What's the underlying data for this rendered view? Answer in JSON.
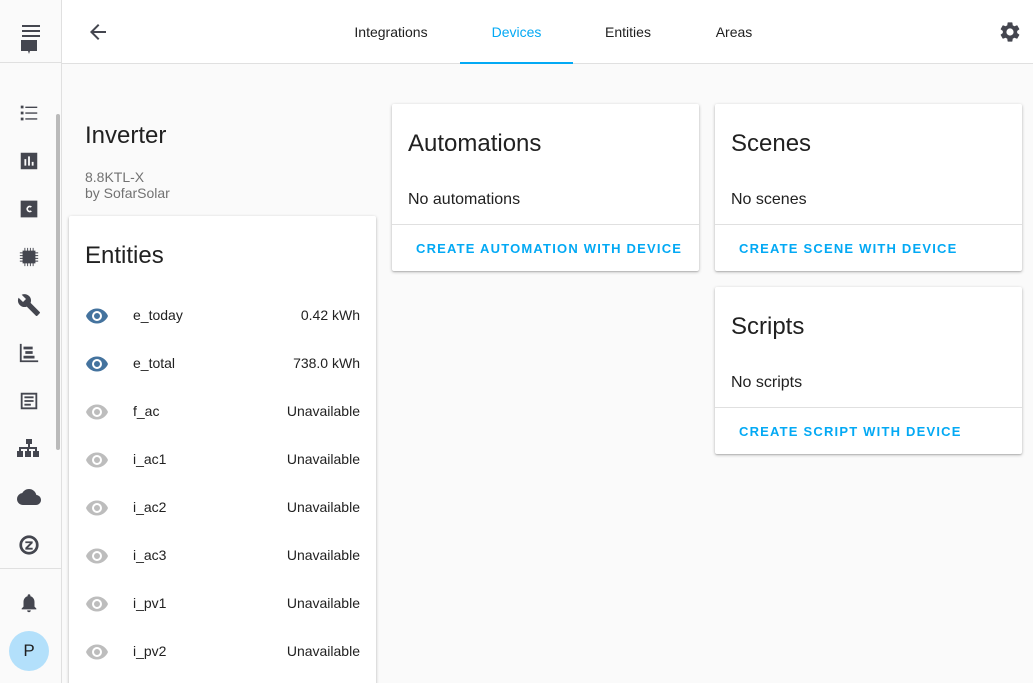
{
  "tabs": [
    {
      "label": "Integrations"
    },
    {
      "label": "Devices",
      "active": true
    },
    {
      "label": "Entities"
    },
    {
      "label": "Areas"
    }
  ],
  "user": {
    "initial": "P"
  },
  "sidebar": {
    "icons": [
      "dashboard-icon",
      "logbook-icon",
      "history-icon",
      "hacs-icon",
      "esphome-icon",
      "developer-tools-icon",
      "node-red-icon",
      "file-editor-icon",
      "zigbee-network-icon",
      "cloud-icon",
      "z-wave-icon",
      "notifications-icon"
    ]
  },
  "device": {
    "name": "Inverter",
    "model": "8.8KTL-X",
    "manufacturer": "by SofarSolar"
  },
  "entities_card": {
    "title": "Entities",
    "rows": [
      {
        "name": "e_today",
        "state": "0.42 kWh",
        "visible": true
      },
      {
        "name": "e_total",
        "state": "738.0 kWh",
        "visible": true
      },
      {
        "name": "f_ac",
        "state": "Unavailable",
        "visible": false
      },
      {
        "name": "i_ac1",
        "state": "Unavailable",
        "visible": false
      },
      {
        "name": "i_ac2",
        "state": "Unavailable",
        "visible": false
      },
      {
        "name": "i_ac3",
        "state": "Unavailable",
        "visible": false
      },
      {
        "name": "i_pv1",
        "state": "Unavailable",
        "visible": false
      },
      {
        "name": "i_pv2",
        "state": "Unavailable",
        "visible": false
      }
    ]
  },
  "automations_card": {
    "title": "Automations",
    "empty_text": "No automations",
    "action_label": "CREATE AUTOMATION WITH DEVICE"
  },
  "scenes_card": {
    "title": "Scenes",
    "empty_text": "No scenes",
    "action_label": "CREATE SCENE WITH DEVICE"
  },
  "scripts_card": {
    "title": "Scripts",
    "empty_text": "No scripts",
    "action_label": "CREATE SCRIPT WITH DEVICE"
  },
  "colors": {
    "accent": "#03a9f4",
    "eye_active": "#44739e",
    "eye_inactive": "#bdbdbd",
    "sidebar_icon": "#44464f"
  }
}
